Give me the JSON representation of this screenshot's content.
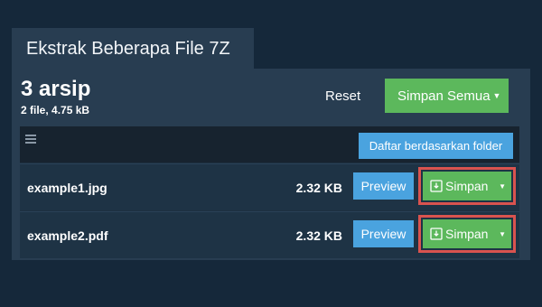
{
  "tab": {
    "title": "Ekstrak Beberapa File 7Z"
  },
  "header": {
    "archive_count": "3 arsip",
    "summary": "2 file, 4.75 kB",
    "reset_label": "Reset",
    "save_all_label": "Simpan Semua"
  },
  "list": {
    "folder_button_label": "Daftar berdasarkan folder",
    "files": [
      {
        "name": "example1.jpg",
        "size": "2.32 KB",
        "preview_label": "Preview",
        "save_label": "Simpan"
      },
      {
        "name": "example2.pdf",
        "size": "2.32 KB",
        "preview_label": "Preview",
        "save_label": "Simpan"
      }
    ]
  },
  "colors": {
    "background": "#15283a",
    "panel": "#283d51",
    "green": "#5cb85c",
    "blue": "#4aa3df",
    "highlight": "#d9534f"
  },
  "icons": {
    "menu": "hamburger-icon",
    "caret": "caret-down-icon",
    "download": "download-icon"
  }
}
